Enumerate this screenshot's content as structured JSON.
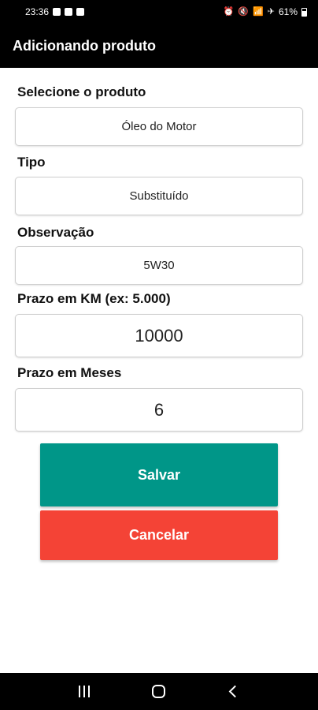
{
  "status_bar": {
    "time": "23:36",
    "battery": "61%"
  },
  "app_bar": {
    "title": "Adicionando produto"
  },
  "form": {
    "product": {
      "label": "Selecione o produto",
      "value": "Óleo do Motor"
    },
    "type": {
      "label": "Tipo",
      "value": "Substituído"
    },
    "note": {
      "label": "Observação",
      "value": "5W30"
    },
    "km_deadline": {
      "label": "Prazo em KM (ex: 5.000)",
      "value": "10000"
    },
    "months_deadline": {
      "label": "Prazo em Meses",
      "value": "6"
    }
  },
  "buttons": {
    "save": "Salvar",
    "cancel": "Cancelar"
  },
  "colors": {
    "save": "#009688",
    "cancel": "#f44336",
    "app_bar": "#000000"
  },
  "nav_icons": [
    "recents-icon",
    "home-icon",
    "back-icon"
  ]
}
